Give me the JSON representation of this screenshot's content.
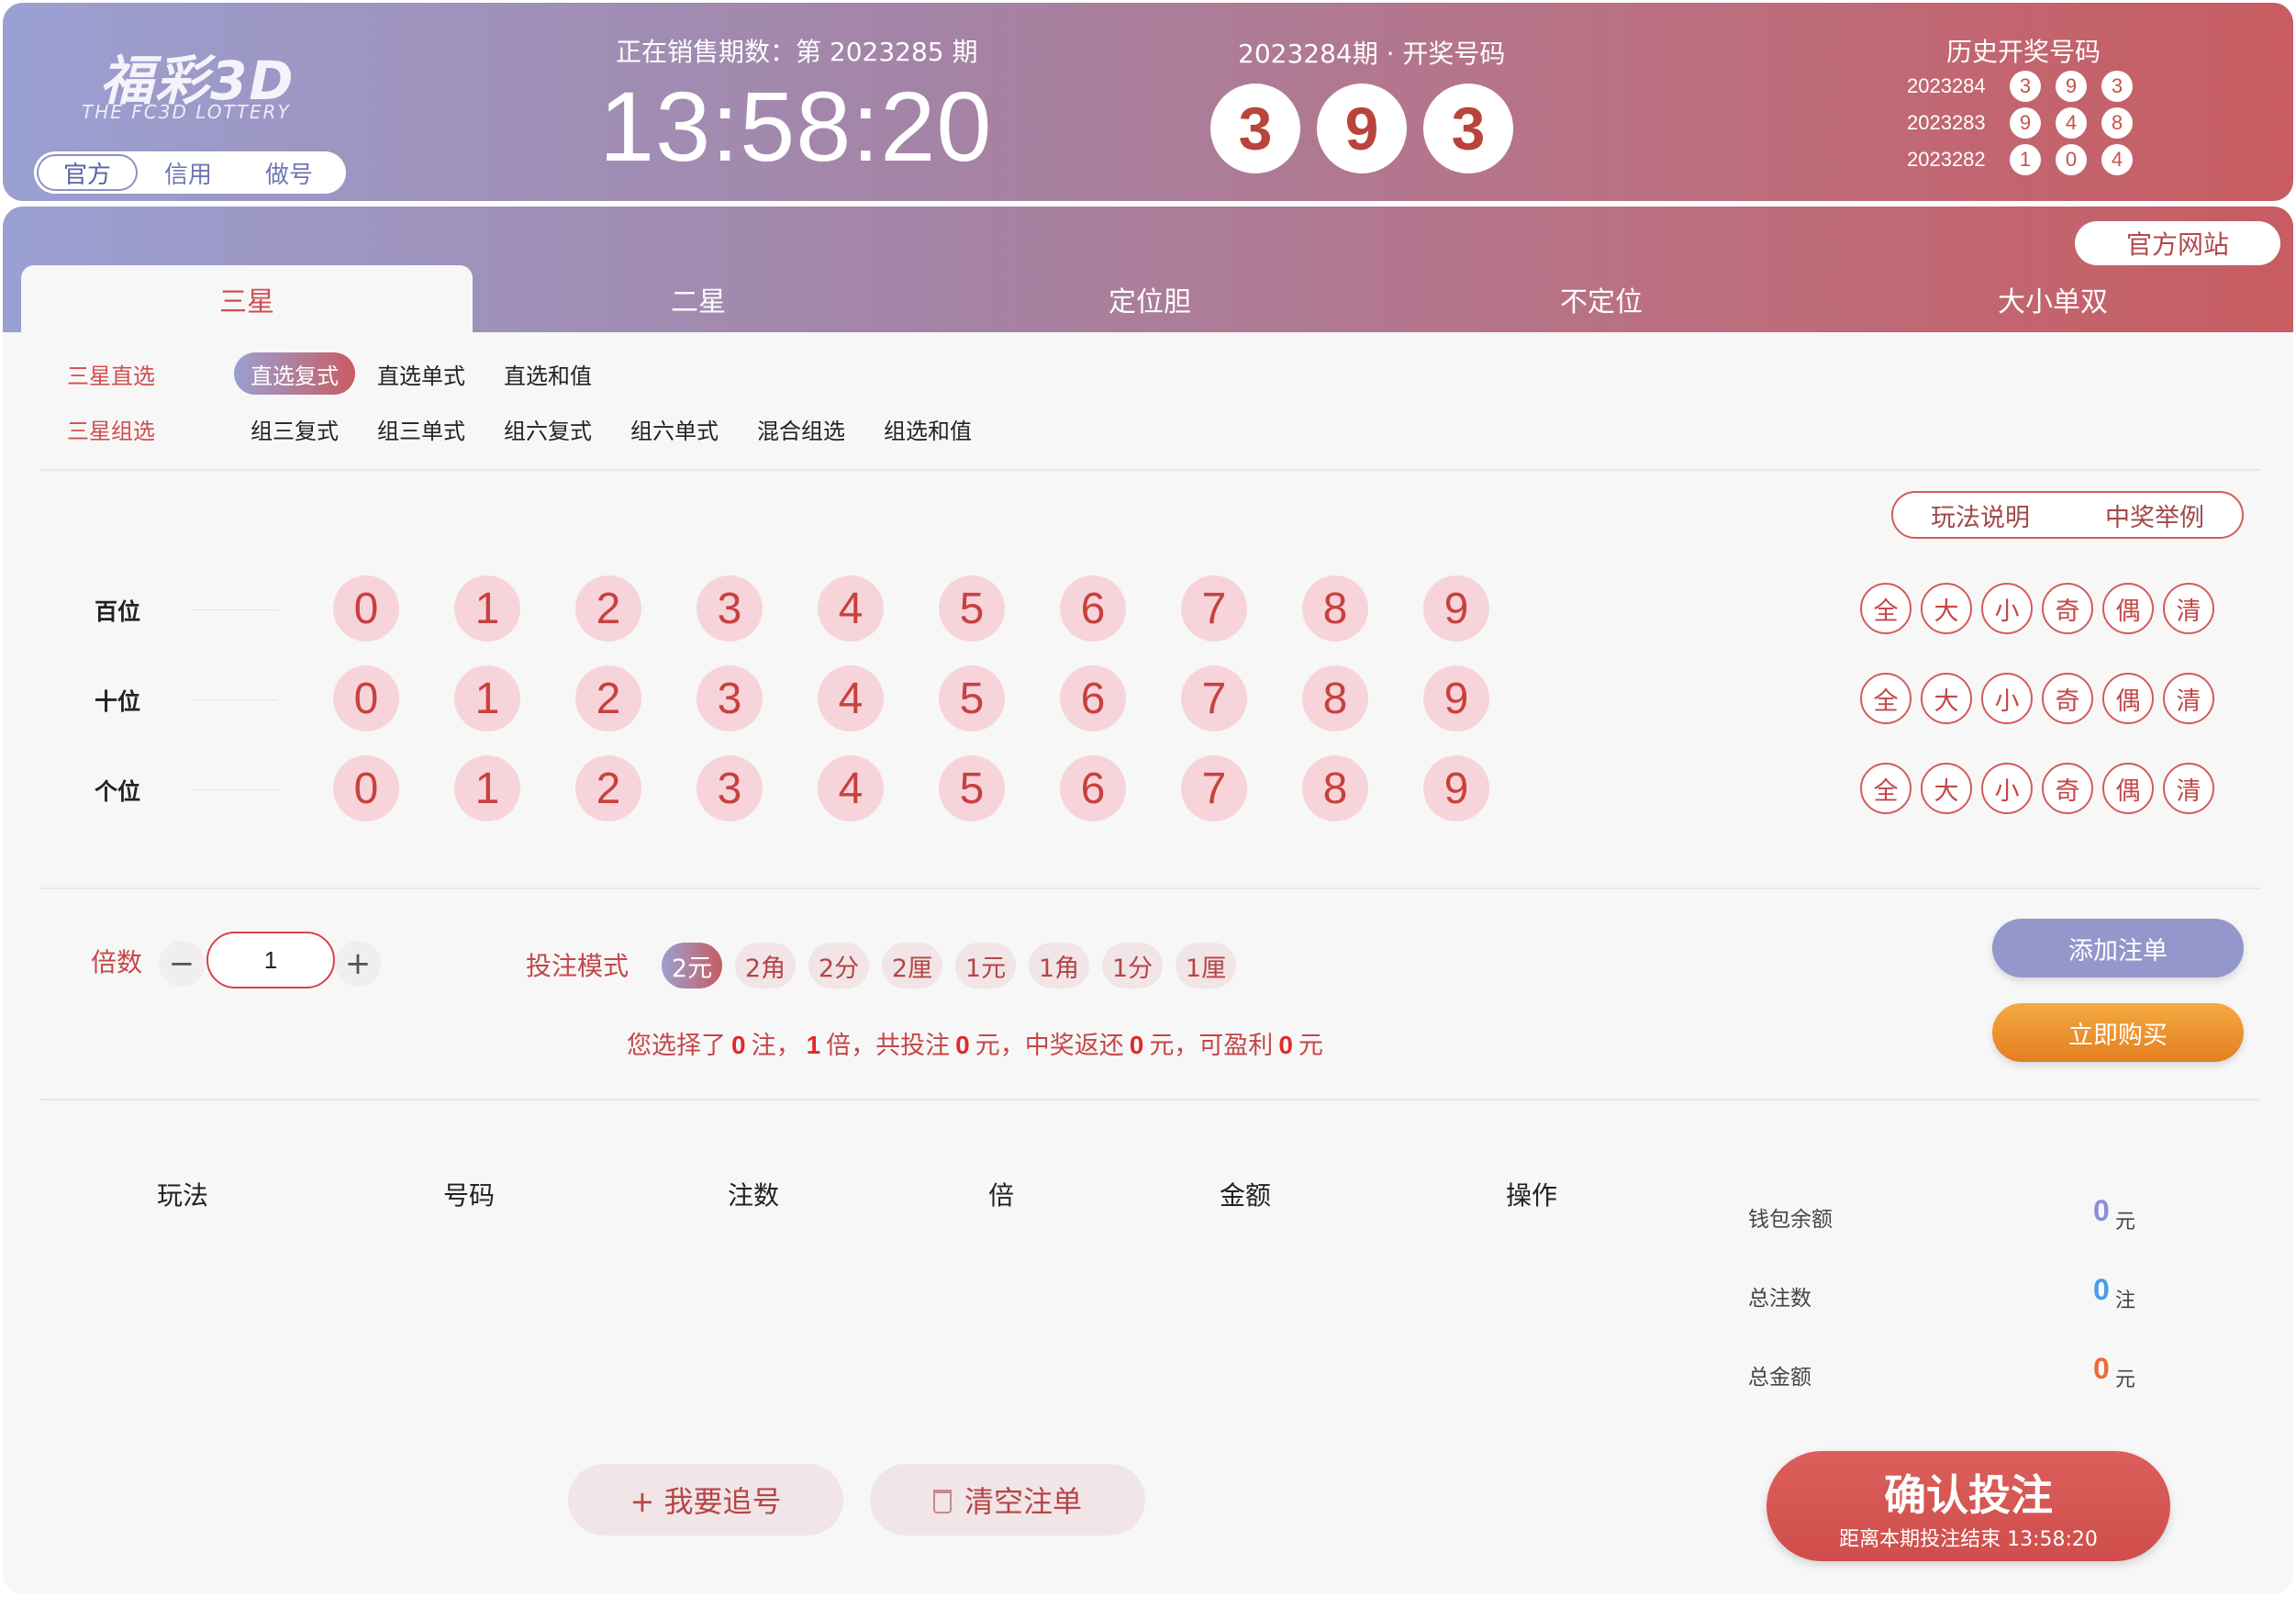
{
  "header": {
    "logo_title": "福彩3D",
    "logo_subtitle": "THE FC3D LOTTERY",
    "modes": [
      "官方",
      "信用",
      "做号"
    ],
    "active_mode": "官方",
    "sale_label": "正在销售期数：第 2023285 期",
    "countdown": "13:58:20",
    "draw_label": "2023284期 · 开奖号码",
    "draw_numbers": [
      "3",
      "9",
      "3"
    ],
    "history_title": "历史开奖号码",
    "history": [
      {
        "period": "2023284",
        "numbers": [
          "3",
          "9",
          "3"
        ]
      },
      {
        "period": "2023283",
        "numbers": [
          "9",
          "4",
          "8"
        ]
      },
      {
        "period": "2023282",
        "numbers": [
          "1",
          "0",
          "4"
        ]
      }
    ]
  },
  "official_site": "官方网站",
  "tabs": [
    "三星",
    "二星",
    "定位胆",
    "不定位",
    "大小单双"
  ],
  "active_tab": "三星",
  "subtypes": [
    {
      "group": "三星直选",
      "items": [
        "直选复式",
        "直选单式",
        "直选和值"
      ]
    },
    {
      "group": "三星组选",
      "items": [
        "组三复式",
        "组三单式",
        "组六复式",
        "组六单式",
        "混合组选",
        "组选和值"
      ]
    }
  ],
  "active_subtype": "直选复式",
  "help": {
    "rules": "玩法说明",
    "example": "中奖举例"
  },
  "positions": [
    "百位",
    "十位",
    "个位"
  ],
  "digits": [
    "0",
    "1",
    "2",
    "3",
    "4",
    "5",
    "6",
    "7",
    "8",
    "9"
  ],
  "quick_selects": [
    "全",
    "大",
    "小",
    "奇",
    "偶",
    "清"
  ],
  "multiplier": {
    "label": "倍数",
    "value": "1",
    "minus": "−",
    "plus": "+"
  },
  "bet_mode": {
    "label": "投注模式",
    "units": [
      "2元",
      "2角",
      "2分",
      "2厘",
      "1元",
      "1角",
      "1分",
      "1厘"
    ],
    "active": "2元"
  },
  "summary": {
    "p1": "您选择了",
    "bets": "0",
    "p2": "注，",
    "multiple": "1",
    "p3": "倍，共投注",
    "amount": "0",
    "p4": "元，中奖返还",
    "payout": "0",
    "p5": "元，可盈利",
    "profit": "0",
    "p6": "元"
  },
  "buttons": {
    "add": "添加注单",
    "buy": "立即购买",
    "chase": "+ 我要追号",
    "clear": "清空注单"
  },
  "table_headers": [
    "玩法",
    "号码",
    "注数",
    "倍",
    "金额",
    "操作"
  ],
  "stats": [
    {
      "label": "钱包余额",
      "value": "0",
      "unit": "元",
      "color": "#8b8fd6"
    },
    {
      "label": "总注数",
      "value": "0",
      "unit": "注",
      "color": "#4a9ce8"
    },
    {
      "label": "总金额",
      "value": "0",
      "unit": "元",
      "color": "#ef6a3a"
    }
  ],
  "confirm": {
    "title": "确认投注",
    "subtitle": "距离本期投注结束 13:58:20"
  }
}
